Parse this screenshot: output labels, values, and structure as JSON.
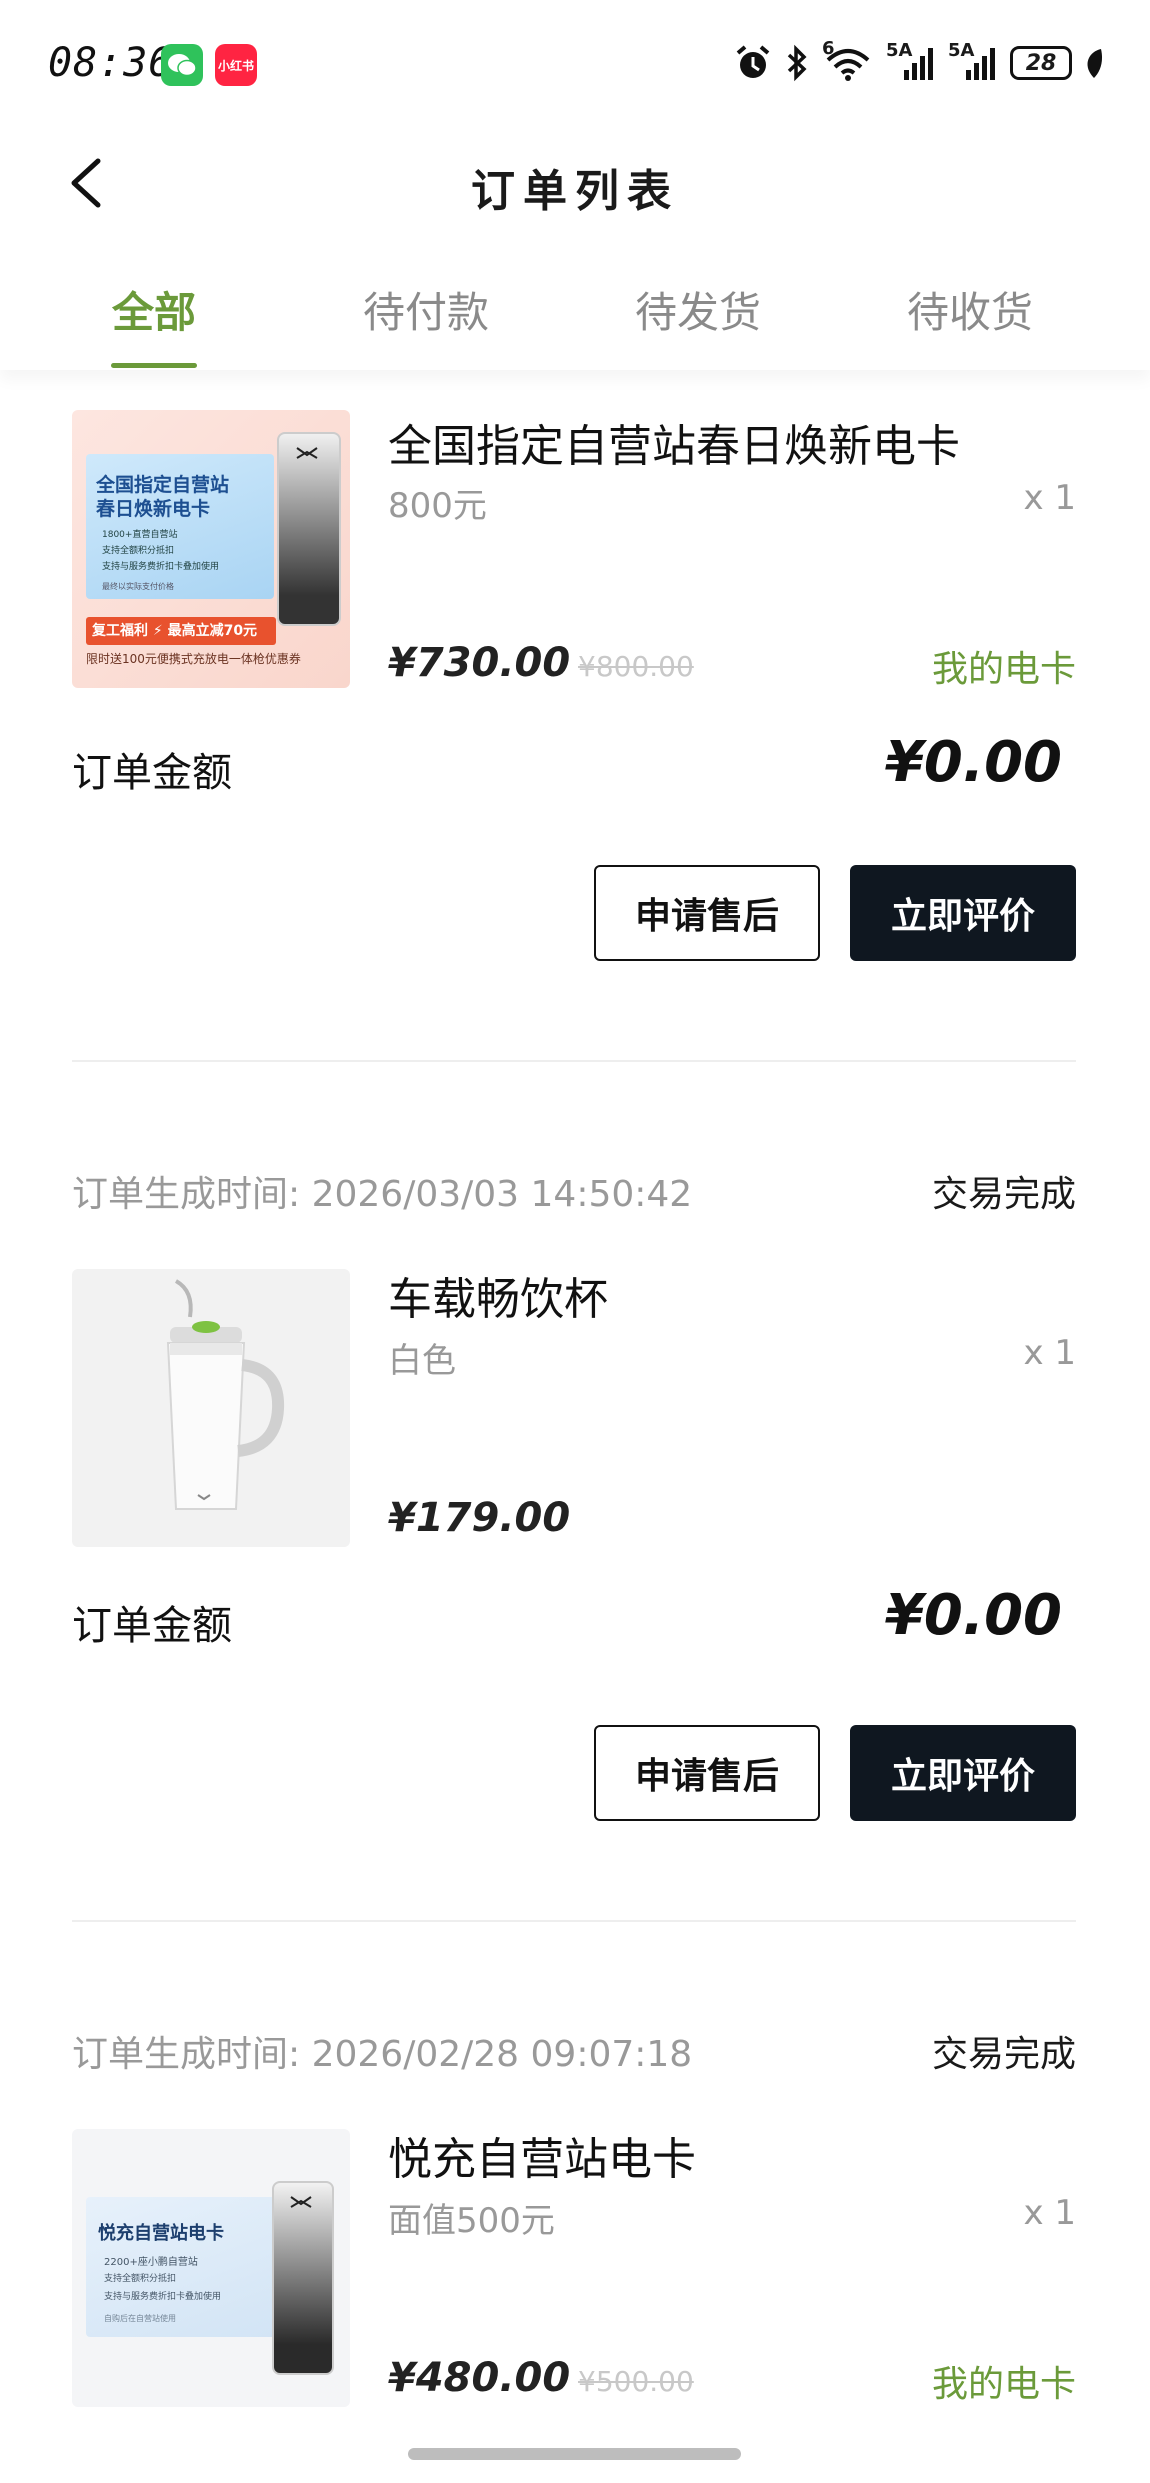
{
  "status_bar": {
    "time": "08:36",
    "apps": [
      {
        "icon": "wechat-icon",
        "color": "#2fc25b",
        "label": ""
      },
      {
        "icon": "xiaohongshu-icon",
        "color": "#ff2442",
        "label": "小红书"
      }
    ],
    "signal1": "5A",
    "signal2": "5A",
    "wifi_label": "6",
    "battery": "28"
  },
  "nav": {
    "title": "订单列表"
  },
  "tabs": [
    {
      "label": "全部",
      "active": true
    },
    {
      "label": "待付款",
      "active": false
    },
    {
      "label": "待发货",
      "active": false
    },
    {
      "label": "待收货",
      "active": false
    }
  ],
  "orders": [
    {
      "product": "全国指定自营站春日焕新电卡",
      "spec": "800元",
      "qty": "x 1",
      "price": "¥730.00",
      "original": "¥800.00",
      "tag": "我的电卡",
      "thumb": {
        "title_line1": "全国指定自营站",
        "title_line2": "春日焕新电卡",
        "bullets": [
          "1800+直营自营站",
          "支持全额积分抵扣",
          "支持与服务费折扣卡叠加使用"
        ],
        "footnote": "最终以实际支付价格",
        "promo": "复工福利 ⚡ 最高立减70元",
        "promo_sub": "限时送100元便携式充放电一体枪优惠券"
      },
      "amount_label": "订单金额",
      "amount": "¥0.00",
      "actions": [
        "申请售后",
        "立即评价"
      ]
    },
    {
      "created_label": "订单生成时间:",
      "created": "2026/03/03 14:50:42",
      "status": "交易完成",
      "product": "车载畅饮杯",
      "spec": "白色",
      "qty": "x 1",
      "price": "¥179.00",
      "amount_label": "订单金额",
      "amount": "¥0.00",
      "actions": [
        "申请售后",
        "立即评价"
      ]
    },
    {
      "created_label": "订单生成时间:",
      "created": "2026/02/28 09:07:18",
      "status": "交易完成",
      "product": "悦充自营站电卡",
      "spec": "面值500元",
      "qty": "x 1",
      "price": "¥480.00",
      "original": "¥500.00",
      "tag": "我的电卡",
      "thumb": {
        "title": "悦充自营站电卡",
        "bullets": [
          "2200+座小鹏自营站",
          "支持全额积分抵扣",
          "支持与服务费折扣卡叠加使用"
        ],
        "footnote": "自购后在自营站使用"
      }
    }
  ],
  "colors": {
    "accent": "#6b9a3a",
    "dark_button": "#0f1720"
  }
}
